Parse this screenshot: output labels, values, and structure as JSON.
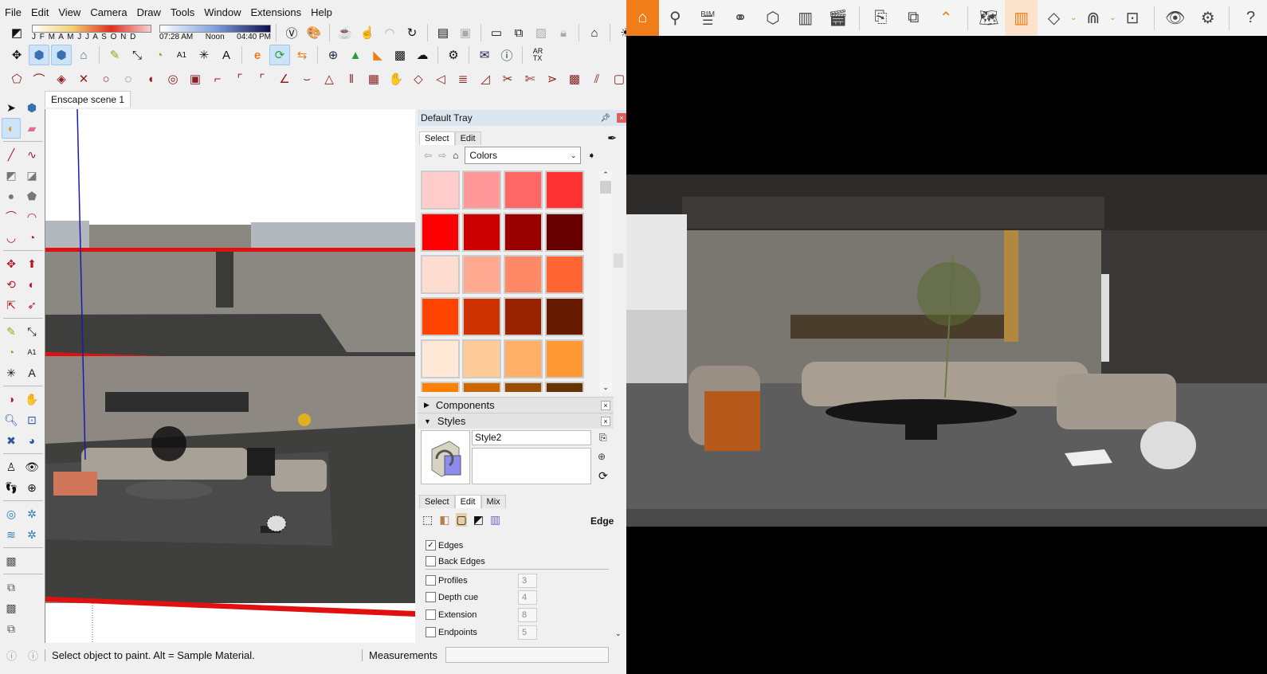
{
  "sketchup": {
    "menu": [
      "File",
      "Edit",
      "View",
      "Camera",
      "Draw",
      "Tools",
      "Window",
      "Extensions",
      "Help"
    ],
    "shadow_months": "J F M A M J J A S O N D",
    "shadow_times": [
      "07:28 AM",
      "Noon",
      "04:40 PM"
    ],
    "scene_tab": "Enscape scene 1",
    "toolbar_icons": [
      "orbit",
      "pan-box",
      "iso-view",
      "house-view",
      "tape-measure",
      "dimension",
      "protractor",
      "text",
      "axes",
      "3d-text",
      "enscape-logo",
      "live-sync",
      "video",
      "add",
      "tree",
      "material-swatch",
      "checker",
      "cloud-upload",
      "settings",
      "mail",
      "info",
      "artx"
    ],
    "status_text": "Select object to paint. Alt = Sample Material.",
    "measurements_label": "Measurements",
    "measurements_value": ""
  },
  "tray": {
    "title": "Default Tray",
    "materials_tabs": [
      "Select",
      "Edit"
    ],
    "materials_active_tab": "Select",
    "library": "Colors",
    "swatches": [
      [
        "#ffcccc",
        "#ff9999",
        "#ff6666",
        "#ff3333"
      ],
      [
        "#ff0000",
        "#cc0000",
        "#990000",
        "#660000"
      ],
      [
        "#ffdcd0",
        "#ffaa90",
        "#ff8866",
        "#ff6633"
      ],
      [
        "#ff4400",
        "#cc3300",
        "#992200",
        "#661a00"
      ],
      [
        "#ffe8d6",
        "#ffcc99",
        "#ffb066",
        "#ff9933"
      ],
      [
        "#ff8000",
        "#cc6600",
        "#994d00",
        "#663300"
      ]
    ],
    "components_label": "Components",
    "styles_label": "Styles",
    "style_name": "Style2",
    "style_description": "",
    "styles_tabs": [
      "Select",
      "Edit",
      "Mix"
    ],
    "styles_active_tab": "Edit",
    "edge_section_label": "Edge",
    "edge_settings": [
      {
        "label": "Edges",
        "checked": true,
        "value": null
      },
      {
        "label": "Back Edges",
        "checked": false,
        "value": null
      },
      {
        "label": "Profiles",
        "checked": false,
        "value": "3"
      },
      {
        "label": "Depth cue",
        "checked": false,
        "value": "4"
      },
      {
        "label": "Extension",
        "checked": false,
        "value": "8"
      },
      {
        "label": "Endpoints",
        "checked": false,
        "value": "5"
      }
    ]
  },
  "enscape": {
    "toolbar": [
      "home",
      "location-chat",
      "bim",
      "binoculars",
      "view-cone",
      "buildings",
      "clapperboard",
      "export-image",
      "batch-export",
      "collapse",
      "map",
      "active-view",
      "section",
      "mountains",
      "vr-headset",
      "visual-settings",
      "settings",
      "help"
    ],
    "bim_label": "BIM",
    "accent": "#f07d1a"
  }
}
